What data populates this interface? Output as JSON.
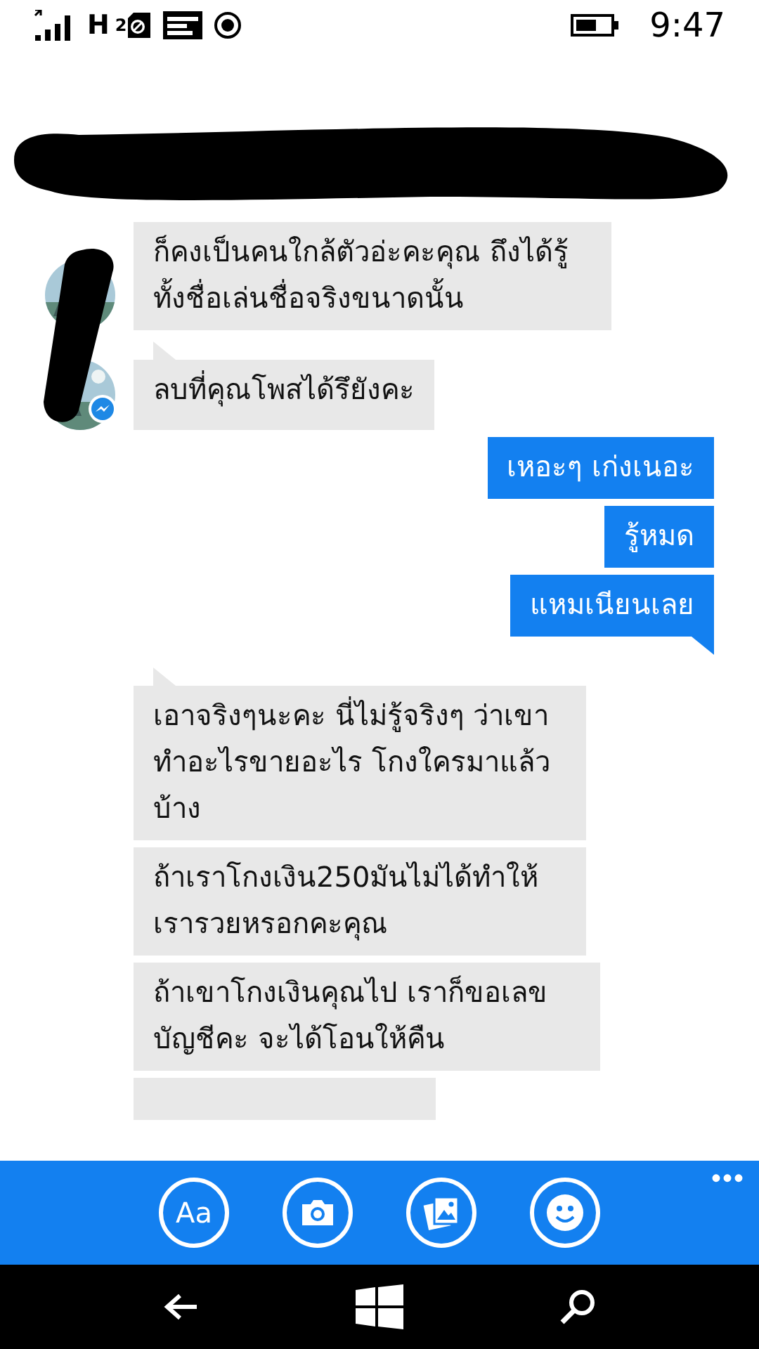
{
  "status_bar": {
    "network": "H",
    "sim": "2",
    "time": "9:47"
  },
  "messages": [
    {
      "kind": "incoming",
      "text": "ก็คงเป็นคนใกล้ตัวอ่ะคะคุณ ถึงได้รู้ทั้งชื่อเล่นชื่อจริงขนาดนั้น",
      "tail": false,
      "avatar": true
    },
    {
      "kind": "incoming",
      "text": "ลบที่คุณโพสได้รึยังคะ",
      "tail": true,
      "avatar": true
    },
    {
      "kind": "outgoing",
      "text": "เหอะๆ เก่งเนอะ",
      "tail": false
    },
    {
      "kind": "outgoing",
      "text": "รู้หมด",
      "tail": false
    },
    {
      "kind": "outgoing",
      "text": "แหมเนียนเลย",
      "tail": true
    },
    {
      "kind": "incoming",
      "text": "เอาจริงๆนะคะ นี่ไม่รู้จริงๆ ว่าเขาทำอะไรขายอะไร โกงใครมาแล้วบ้าง",
      "tail": true,
      "avatar": false
    },
    {
      "kind": "incoming",
      "text": "ถ้าเราโกงเงิน250มันไม่ได้ทำให้เรารวยหรอกคะคุณ",
      "tail": false,
      "avatar": false
    },
    {
      "kind": "incoming",
      "text": "ถ้าเขาโกงเงินคุณไป เราก็ขอเลขบัญชีคะ จะได้โอนให้คืน",
      "tail": false,
      "avatar": false
    }
  ],
  "app_bar": {
    "font_button": "Aa",
    "more": "•••"
  }
}
